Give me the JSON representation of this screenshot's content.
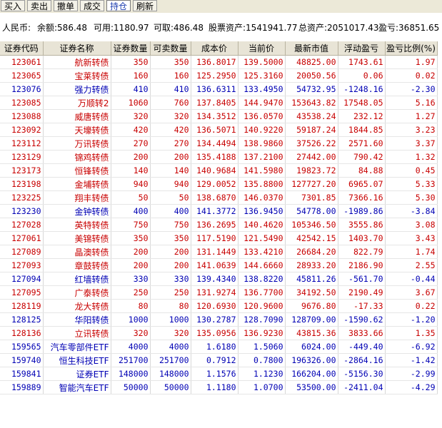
{
  "toolbar": {
    "buttons": [
      "买入",
      "卖出",
      "撤单",
      "成交",
      "持仓",
      "刷新"
    ],
    "active": "持仓"
  },
  "summary": {
    "currency": "人民币:",
    "balance": "余额:586.48",
    "available": "可用:1180.97",
    "withdrawable": "可取:486.48",
    "stock_assets": "股票资产:1541941.77",
    "total_assets": "总资产:2051017.43",
    "profit": "盈亏:36851.65"
  },
  "columns": [
    "证券代码",
    "证券名称",
    "证券数量",
    "可卖数量",
    "成本价",
    "当前价",
    "最新市值",
    "浮动盈亏",
    "盈亏比例(%)"
  ],
  "rows": [
    {
      "code": "123061",
      "name": "航新转债",
      "qty": "350",
      "sell": "350",
      "cost": "136.8017",
      "price": "139.5000",
      "mv": "48825.00",
      "pl": "1743.61",
      "pct": "1.97",
      "dir": "up"
    },
    {
      "code": "123065",
      "name": "宝莱转债",
      "qty": "160",
      "sell": "160",
      "cost": "125.2950",
      "price": "125.3160",
      "mv": "20050.56",
      "pl": "0.06",
      "pct": "0.02",
      "dir": "up"
    },
    {
      "code": "123076",
      "name": "强力转债",
      "qty": "410",
      "sell": "410",
      "cost": "136.6311",
      "price": "133.4950",
      "mv": "54732.95",
      "pl": "-1248.16",
      "pct": "-2.30",
      "dir": "down"
    },
    {
      "code": "123085",
      "name": "万顺转2",
      "qty": "1060",
      "sell": "760",
      "cost": "137.8405",
      "price": "144.9470",
      "mv": "153643.82",
      "pl": "17548.05",
      "pct": "5.16",
      "dir": "up"
    },
    {
      "code": "123088",
      "name": "威唐转债",
      "qty": "320",
      "sell": "320",
      "cost": "134.3512",
      "price": "136.0570",
      "mv": "43538.24",
      "pl": "232.12",
      "pct": "1.27",
      "dir": "up"
    },
    {
      "code": "123092",
      "name": "天壕转债",
      "qty": "420",
      "sell": "420",
      "cost": "136.5071",
      "price": "140.9220",
      "mv": "59187.24",
      "pl": "1844.85",
      "pct": "3.23",
      "dir": "up"
    },
    {
      "code": "123112",
      "name": "万讯转债",
      "qty": "270",
      "sell": "270",
      "cost": "134.4494",
      "price": "138.9860",
      "mv": "37526.22",
      "pl": "2571.60",
      "pct": "3.37",
      "dir": "up"
    },
    {
      "code": "123129",
      "name": "锦鸡转债",
      "qty": "200",
      "sell": "200",
      "cost": "135.4188",
      "price": "137.2100",
      "mv": "27442.00",
      "pl": "790.42",
      "pct": "1.32",
      "dir": "up"
    },
    {
      "code": "123173",
      "name": "恒锋转债",
      "qty": "140",
      "sell": "140",
      "cost": "140.9684",
      "price": "141.5980",
      "mv": "19823.72",
      "pl": "84.88",
      "pct": "0.45",
      "dir": "up"
    },
    {
      "code": "123198",
      "name": "金埔转债",
      "qty": "940",
      "sell": "940",
      "cost": "129.0052",
      "price": "135.8800",
      "mv": "127727.20",
      "pl": "6965.07",
      "pct": "5.33",
      "dir": "up"
    },
    {
      "code": "123225",
      "name": "翔丰转债",
      "qty": "50",
      "sell": "50",
      "cost": "138.6870",
      "price": "146.0370",
      "mv": "7301.85",
      "pl": "7366.16",
      "pct": "5.30",
      "dir": "up"
    },
    {
      "code": "123230",
      "name": "金钟转债",
      "qty": "400",
      "sell": "400",
      "cost": "141.3772",
      "price": "136.9450",
      "mv": "54778.00",
      "pl": "-1989.86",
      "pct": "-3.84",
      "dir": "down"
    },
    {
      "code": "127028",
      "name": "英特转债",
      "qty": "750",
      "sell": "750",
      "cost": "136.2695",
      "price": "140.4620",
      "mv": "105346.50",
      "pl": "3555.86",
      "pct": "3.08",
      "dir": "up"
    },
    {
      "code": "127061",
      "name": "美锦转债",
      "qty": "350",
      "sell": "350",
      "cost": "117.5190",
      "price": "121.5490",
      "mv": "42542.15",
      "pl": "1403.70",
      "pct": "3.43",
      "dir": "up"
    },
    {
      "code": "127089",
      "name": "晶澳转债",
      "qty": "200",
      "sell": "200",
      "cost": "131.1449",
      "price": "133.4210",
      "mv": "26684.20",
      "pl": "822.79",
      "pct": "1.74",
      "dir": "up"
    },
    {
      "code": "127093",
      "name": "章鼓转债",
      "qty": "200",
      "sell": "200",
      "cost": "141.0639",
      "price": "144.6660",
      "mv": "28933.20",
      "pl": "2186.90",
      "pct": "2.55",
      "dir": "up"
    },
    {
      "code": "127094",
      "name": "红墙转债",
      "qty": "330",
      "sell": "330",
      "cost": "139.4340",
      "price": "138.8220",
      "mv": "45811.26",
      "pl": "-561.70",
      "pct": "-0.44",
      "dir": "down"
    },
    {
      "code": "127095",
      "name": "广泰转债",
      "qty": "250",
      "sell": "250",
      "cost": "131.9274",
      "price": "136.7700",
      "mv": "34192.50",
      "pl": "2190.49",
      "pct": "3.67",
      "dir": "up"
    },
    {
      "code": "128119",
      "name": "龙大转债",
      "qty": "80",
      "sell": "80",
      "cost": "120.6930",
      "price": "120.9600",
      "mv": "9676.80",
      "pl": "-17.33",
      "pct": "0.22",
      "dir": "up"
    },
    {
      "code": "128125",
      "name": "华阳转债",
      "qty": "1000",
      "sell": "1000",
      "cost": "130.2787",
      "price": "128.7090",
      "mv": "128709.00",
      "pl": "-1590.62",
      "pct": "-1.20",
      "dir": "down"
    },
    {
      "code": "128136",
      "name": "立讯转债",
      "qty": "320",
      "sell": "320",
      "cost": "135.0956",
      "price": "136.9230",
      "mv": "43815.36",
      "pl": "3833.66",
      "pct": "1.35",
      "dir": "up"
    },
    {
      "code": "159565",
      "name": "汽车零部件ETF",
      "qty": "4000",
      "sell": "4000",
      "cost": "1.6180",
      "price": "1.5060",
      "mv": "6024.00",
      "pl": "-449.40",
      "pct": "-6.92",
      "dir": "down"
    },
    {
      "code": "159740",
      "name": "恒生科技ETF",
      "qty": "251700",
      "sell": "251700",
      "cost": "0.7912",
      "price": "0.7800",
      "mv": "196326.00",
      "pl": "-2864.16",
      "pct": "-1.42",
      "dir": "down"
    },
    {
      "code": "159841",
      "name": "证券ETF",
      "qty": "148000",
      "sell": "148000",
      "cost": "1.1576",
      "price": "1.1230",
      "mv": "166204.00",
      "pl": "-5156.30",
      "pct": "-2.99",
      "dir": "down"
    },
    {
      "code": "159889",
      "name": "智能汽车ETF",
      "qty": "50000",
      "sell": "50000",
      "cost": "1.1180",
      "price": "1.0700",
      "mv": "53500.00",
      "pl": "-2411.04",
      "pct": "-4.29",
      "dir": "down"
    }
  ]
}
